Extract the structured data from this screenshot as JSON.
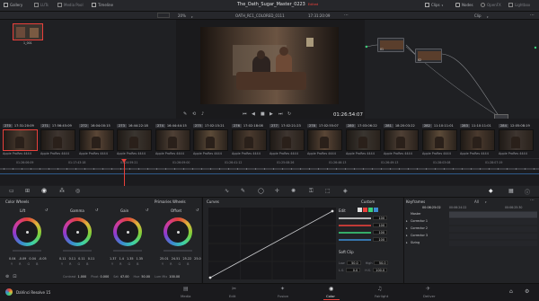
{
  "toolbar": {
    "gallery": "Gallery",
    "luts": "LUTs",
    "media_pool": "Media Pool",
    "timeline": "Timeline",
    "project_title": "The_Oath_Sugar_Master_0223",
    "edited": "Edited",
    "clips": "Clips",
    "nodes": "Nodes",
    "openfx": "OpenFX",
    "lightbox": "Lightbox"
  },
  "viewer": {
    "zoom": "20%",
    "timeline_name": "OATH_RC1_COLORED_0111",
    "source_tc": "17:31:20:09",
    "timecode": "01:26:54:07",
    "node_mode": "Clip",
    "thumb_label": "1_001"
  },
  "nodes": [
    {
      "label": "01"
    },
    {
      "label": "02"
    }
  ],
  "clips": [
    {
      "num": "270",
      "tc": "17:31:20:09",
      "codec": "Apple ProRes 4444"
    },
    {
      "num": "271",
      "tc": "17:56:45:09",
      "codec": "Apple ProRes 4444"
    },
    {
      "num": "272",
      "tc": "16:04:00:15",
      "codec": "Apple ProRes 4444"
    },
    {
      "num": "273",
      "tc": "16:44:22:18",
      "codec": "Apple ProRes 4444"
    },
    {
      "num": "274",
      "tc": "16:44:44:15",
      "codec": "Apple ProRes 4444"
    },
    {
      "num": "275",
      "tc": "17:02:15:21",
      "codec": "Apple ProRes 4444"
    },
    {
      "num": "276",
      "tc": "17:02:18:08",
      "codec": "Apple ProRes 4444"
    },
    {
      "num": "277",
      "tc": "17:02:21:23",
      "codec": "Apple ProRes 4444"
    },
    {
      "num": "278",
      "tc": "17:02:55:07",
      "codec": "Apple ProRes 4444"
    },
    {
      "num": "280",
      "tc": "17:03:06:22",
      "codec": "Apple ProRes 4444"
    },
    {
      "num": "281",
      "tc": "18:20:03:22",
      "codec": "Apple ProRes 4444"
    },
    {
      "num": "282",
      "tc": "11:10:11:01",
      "codec": "Apple ProRes 4444"
    },
    {
      "num": "283",
      "tc": "11:10:11:01",
      "codec": "Apple ProRes 4444"
    },
    {
      "num": "284",
      "tc": "12:05:08:19",
      "codec": "Apple ProRes 4444"
    }
  ],
  "ruler": [
    "01:26:06:09",
    "01:17:43:18",
    "01:24:59:21",
    "01:26:09:00",
    "01:26:41:12",
    "01:25:08:26",
    "01:26:46:13",
    "01:26:49:13",
    "01:28:03:08",
    "01:28:07:19"
  ],
  "color_wheels": {
    "title": "Color Wheels",
    "mode": "Primaries Wheels",
    "wheels": [
      {
        "name": "Lift",
        "values": [
          "0.04",
          "-0.09",
          "0.04",
          -0.05
        ]
      },
      {
        "name": "Gamma",
        "values": [
          "0.11",
          "0.11",
          "0.11",
          "0.11"
        ]
      },
      {
        "name": "Gain",
        "values": [
          "1.37",
          "1.4",
          "1.35",
          "1.35"
        ]
      },
      {
        "name": "Offset",
        "values": [
          "25.01",
          "24.51",
          "25.22",
          "25.0"
        ]
      }
    ],
    "bottom": {
      "contrast_label": "Contrast",
      "contrast": "1.000",
      "pivot_label": "Pivot",
      "pivot": "0.000",
      "sat_label": "Sat",
      "sat": "47.00",
      "hue_label": "Hue",
      "hue": "50.00",
      "lummix_label": "Lum Mix",
      "lummix": "100.00"
    }
  },
  "curves": {
    "title": "Curves",
    "custom": "Custom",
    "edit": "Edit",
    "values": [
      "100",
      "100",
      "100",
      "100"
    ],
    "soft_clip": "Soft Clip",
    "low_label": "Low",
    "low": "50.0",
    "high_label": "High",
    "high": "50.0",
    "ls_label": "L.S.",
    "ls": "0.0",
    "hs_label": "H.S.",
    "hs": "100.0"
  },
  "keyframes": {
    "title": "Keyframes",
    "all": "All",
    "tc1": "00:06:25:02",
    "tc2": "00:06:25:02",
    "tc_ruler1": "00:06:24:22",
    "tc_ruler2": "00:06:25:30",
    "tracks": [
      "Master",
      "Corrector 1",
      "Corrector 2",
      "Corrector 3",
      "Sizing"
    ]
  },
  "bottom_tabs": [
    "Media",
    "Edit",
    "Fusion",
    "Color",
    "Fairlight",
    "Deliver"
  ],
  "app_name": "DaVinci Resolve 15",
  "colors": {
    "accent": "#e8403b",
    "bg": "#1d1d20"
  }
}
